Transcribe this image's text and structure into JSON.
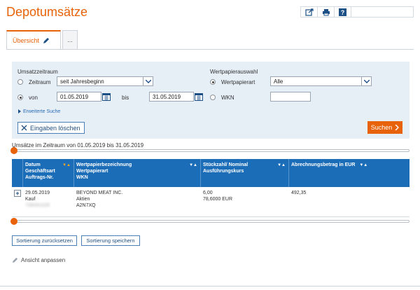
{
  "page": {
    "title": "Depotumsätze"
  },
  "tabs": [
    {
      "label": "Übersicht"
    },
    {
      "label": "..."
    }
  ],
  "search": {
    "umsatzzeitraum_label": "Umsatzzeitraum",
    "zeitraum_label": "Zeitraum",
    "zeitraum_value": "seit Jahresbeginn",
    "von_label": "von",
    "von_value": "01.05.2019",
    "bis_label": "bis",
    "bis_value": "31.05.2019",
    "erweiterte_suche": "Erweiterte Suche",
    "wertpapierauswahl_label": "Wertpapierauswahl",
    "wertpapierart_label": "Wertpapierart",
    "wertpapierart_value": "Alle",
    "wkn_label": "WKN",
    "wkn_value": "",
    "clear_button": "Eingaben löschen",
    "search_button": "Suchen"
  },
  "range_text": "Umsätze im Zeitraum von 01.05.2019 bis 31.05.2019",
  "table": {
    "headers": [
      {
        "l1": "Datum",
        "l2": "Geschäftsart",
        "l3": "Auftrags-Nr."
      },
      {
        "l1": "Wertpapierbezeichnung",
        "l2": "Wertpapierart",
        "l3": "WKN"
      },
      {
        "l1": "Stückzahl/ Nominal",
        "l2": "Ausführungskurs",
        "l3": ""
      },
      {
        "l1": "Abrechnungsbetrag in EUR",
        "l2": "",
        "l3": ""
      }
    ],
    "rows": [
      {
        "datum": "29.05.2019",
        "geschaeftsart": "Kauf",
        "auftragsnr": "738491026",
        "bezeichnung": "BEYOND MEAT INC.",
        "art": "Aktien",
        "wkn": "A2N7XQ",
        "stueckzahl": "6,00",
        "kurs": "78,6000 EUR",
        "betrag": "492,35"
      }
    ]
  },
  "buttons": {
    "reset_sort": "Sortierung zurücksetzen",
    "save_sort": "Sortierung speichern"
  },
  "adjust_view": "Ansicht anpassen",
  "colors": {
    "accent": "#e8620a",
    "table_header": "#1c6db8",
    "panel": "#e6eef6"
  }
}
